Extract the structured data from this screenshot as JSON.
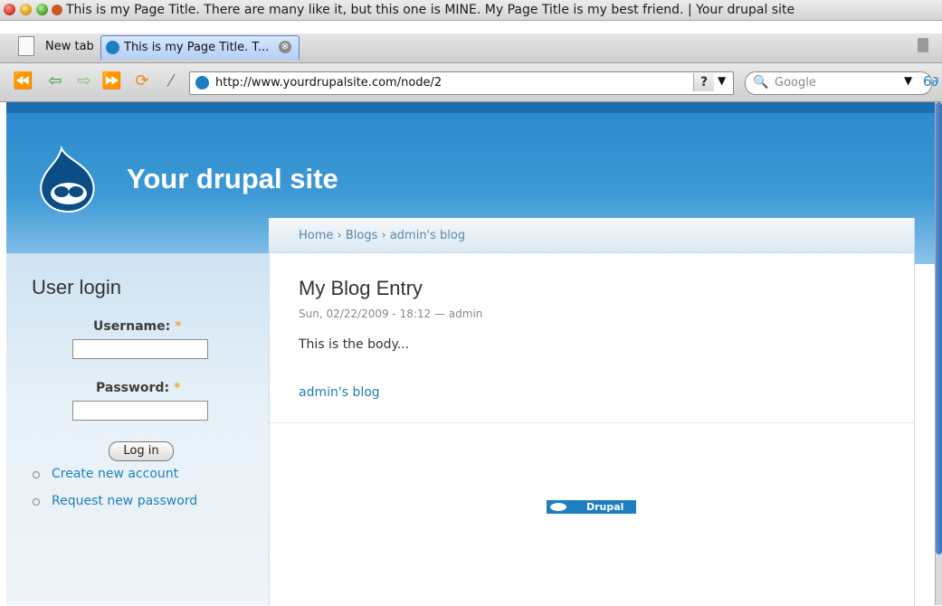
{
  "window": {
    "title": "This is my Page Title. There are many like it, but this one is MINE. My Page Title is my best friend. | Your drupal site"
  },
  "tabs": {
    "new_tab_label": "New tab",
    "active_tab_label": "This is my Page Title. T...",
    "close_symbol": "⊗"
  },
  "navbar": {
    "back_icon": "⏪",
    "prev_icon": "⇦",
    "next_icon": "⇨",
    "forward_icon": "⏩",
    "reload_icon": "⟳",
    "stop_icon": "⁄",
    "url": "http://www.yourdrupalsite.com/node/2",
    "help_label": "?",
    "dropdown_arrow": "▼",
    "search_placeholder": "Google",
    "search_icon": "🔍",
    "extra_icon": "6∂"
  },
  "site": {
    "name": "Your drupal site",
    "brand_color": "#1f7ec2"
  },
  "breadcrumb": "Home › Blogs › admin's blog",
  "sidebar": {
    "title": "User login",
    "username_label": "Username:",
    "password_label": "Password:",
    "required_mark": "*",
    "login_button": "Log in",
    "links": [
      "Create new account",
      "Request new password"
    ]
  },
  "node": {
    "title": "My Blog Entry",
    "meta": "Sun, 02/22/2009 - 18:12 — admin",
    "body": "This is the body...",
    "link": "admin's blog"
  },
  "footer": {
    "powered_by": "Drupal"
  }
}
